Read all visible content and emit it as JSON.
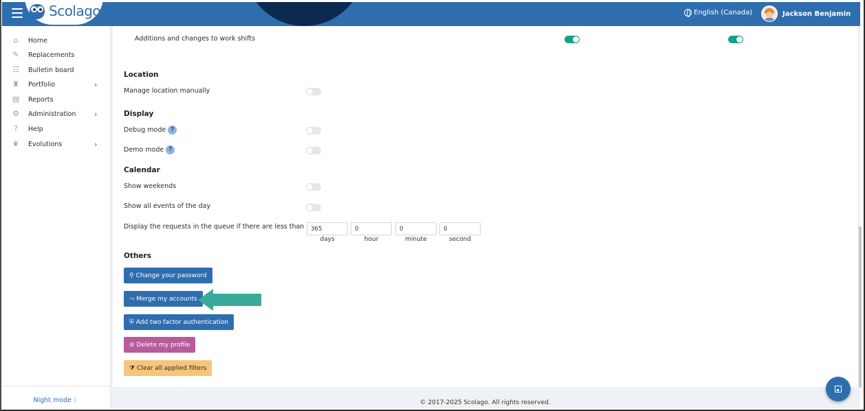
{
  "header": {
    "logo_text": "Scolago",
    "language": "English (Canada)",
    "user_name": "Jackson Benjamin",
    "brand_color": "#2f6eae"
  },
  "sidebar": {
    "items": [
      {
        "label": "Home",
        "icon": "home-icon"
      },
      {
        "label": "Replacements",
        "icon": "replacements-icon"
      },
      {
        "label": "Bulletin board",
        "icon": "bulletin-board-icon"
      },
      {
        "label": "Portfolio",
        "icon": "trophy-icon",
        "has_submenu": true
      },
      {
        "label": "Reports",
        "icon": "report-icon"
      },
      {
        "label": "Administration",
        "icon": "gear-icon",
        "has_submenu": true
      },
      {
        "label": "Help",
        "icon": "question-icon"
      },
      {
        "label": "Evolutions",
        "icon": "sprout-icon",
        "has_submenu": true
      }
    ],
    "night_mode": "Night mode"
  },
  "settings": {
    "shift_row": {
      "label": "Additions and changes to work shifts",
      "toggle1": true,
      "toggle2": true
    },
    "location": {
      "title": "Location",
      "manage_label": "Manage location manually",
      "manage_on": false
    },
    "display": {
      "title": "Display",
      "debug_label": "Debug mode",
      "demo_label": "Demo mode",
      "help_glyph": "?"
    },
    "calendar": {
      "title": "Calendar",
      "weekends_label": "Show weekends",
      "all_events_label": "Show all events of the day",
      "queue_label": "Display the requests in the queue if there are less than",
      "days": "365",
      "hours": "0",
      "minutes": "0",
      "seconds": "0",
      "days_unit": "days",
      "hour_unit": "hour",
      "minute_unit": "minute",
      "second_unit": "second"
    },
    "others": {
      "title": "Others",
      "change_password": "Change your password",
      "merge_accounts": "Merge my accounts",
      "two_factor": "Add two factor authentication",
      "delete_profile": "Delete my profile",
      "clear_filters": "Clear all applied filters"
    }
  },
  "footer": {
    "copyright": "© 2017-2025 Scolago. All rights reserved."
  },
  "annotation": {
    "arrow_color": "#3aaa9a"
  }
}
